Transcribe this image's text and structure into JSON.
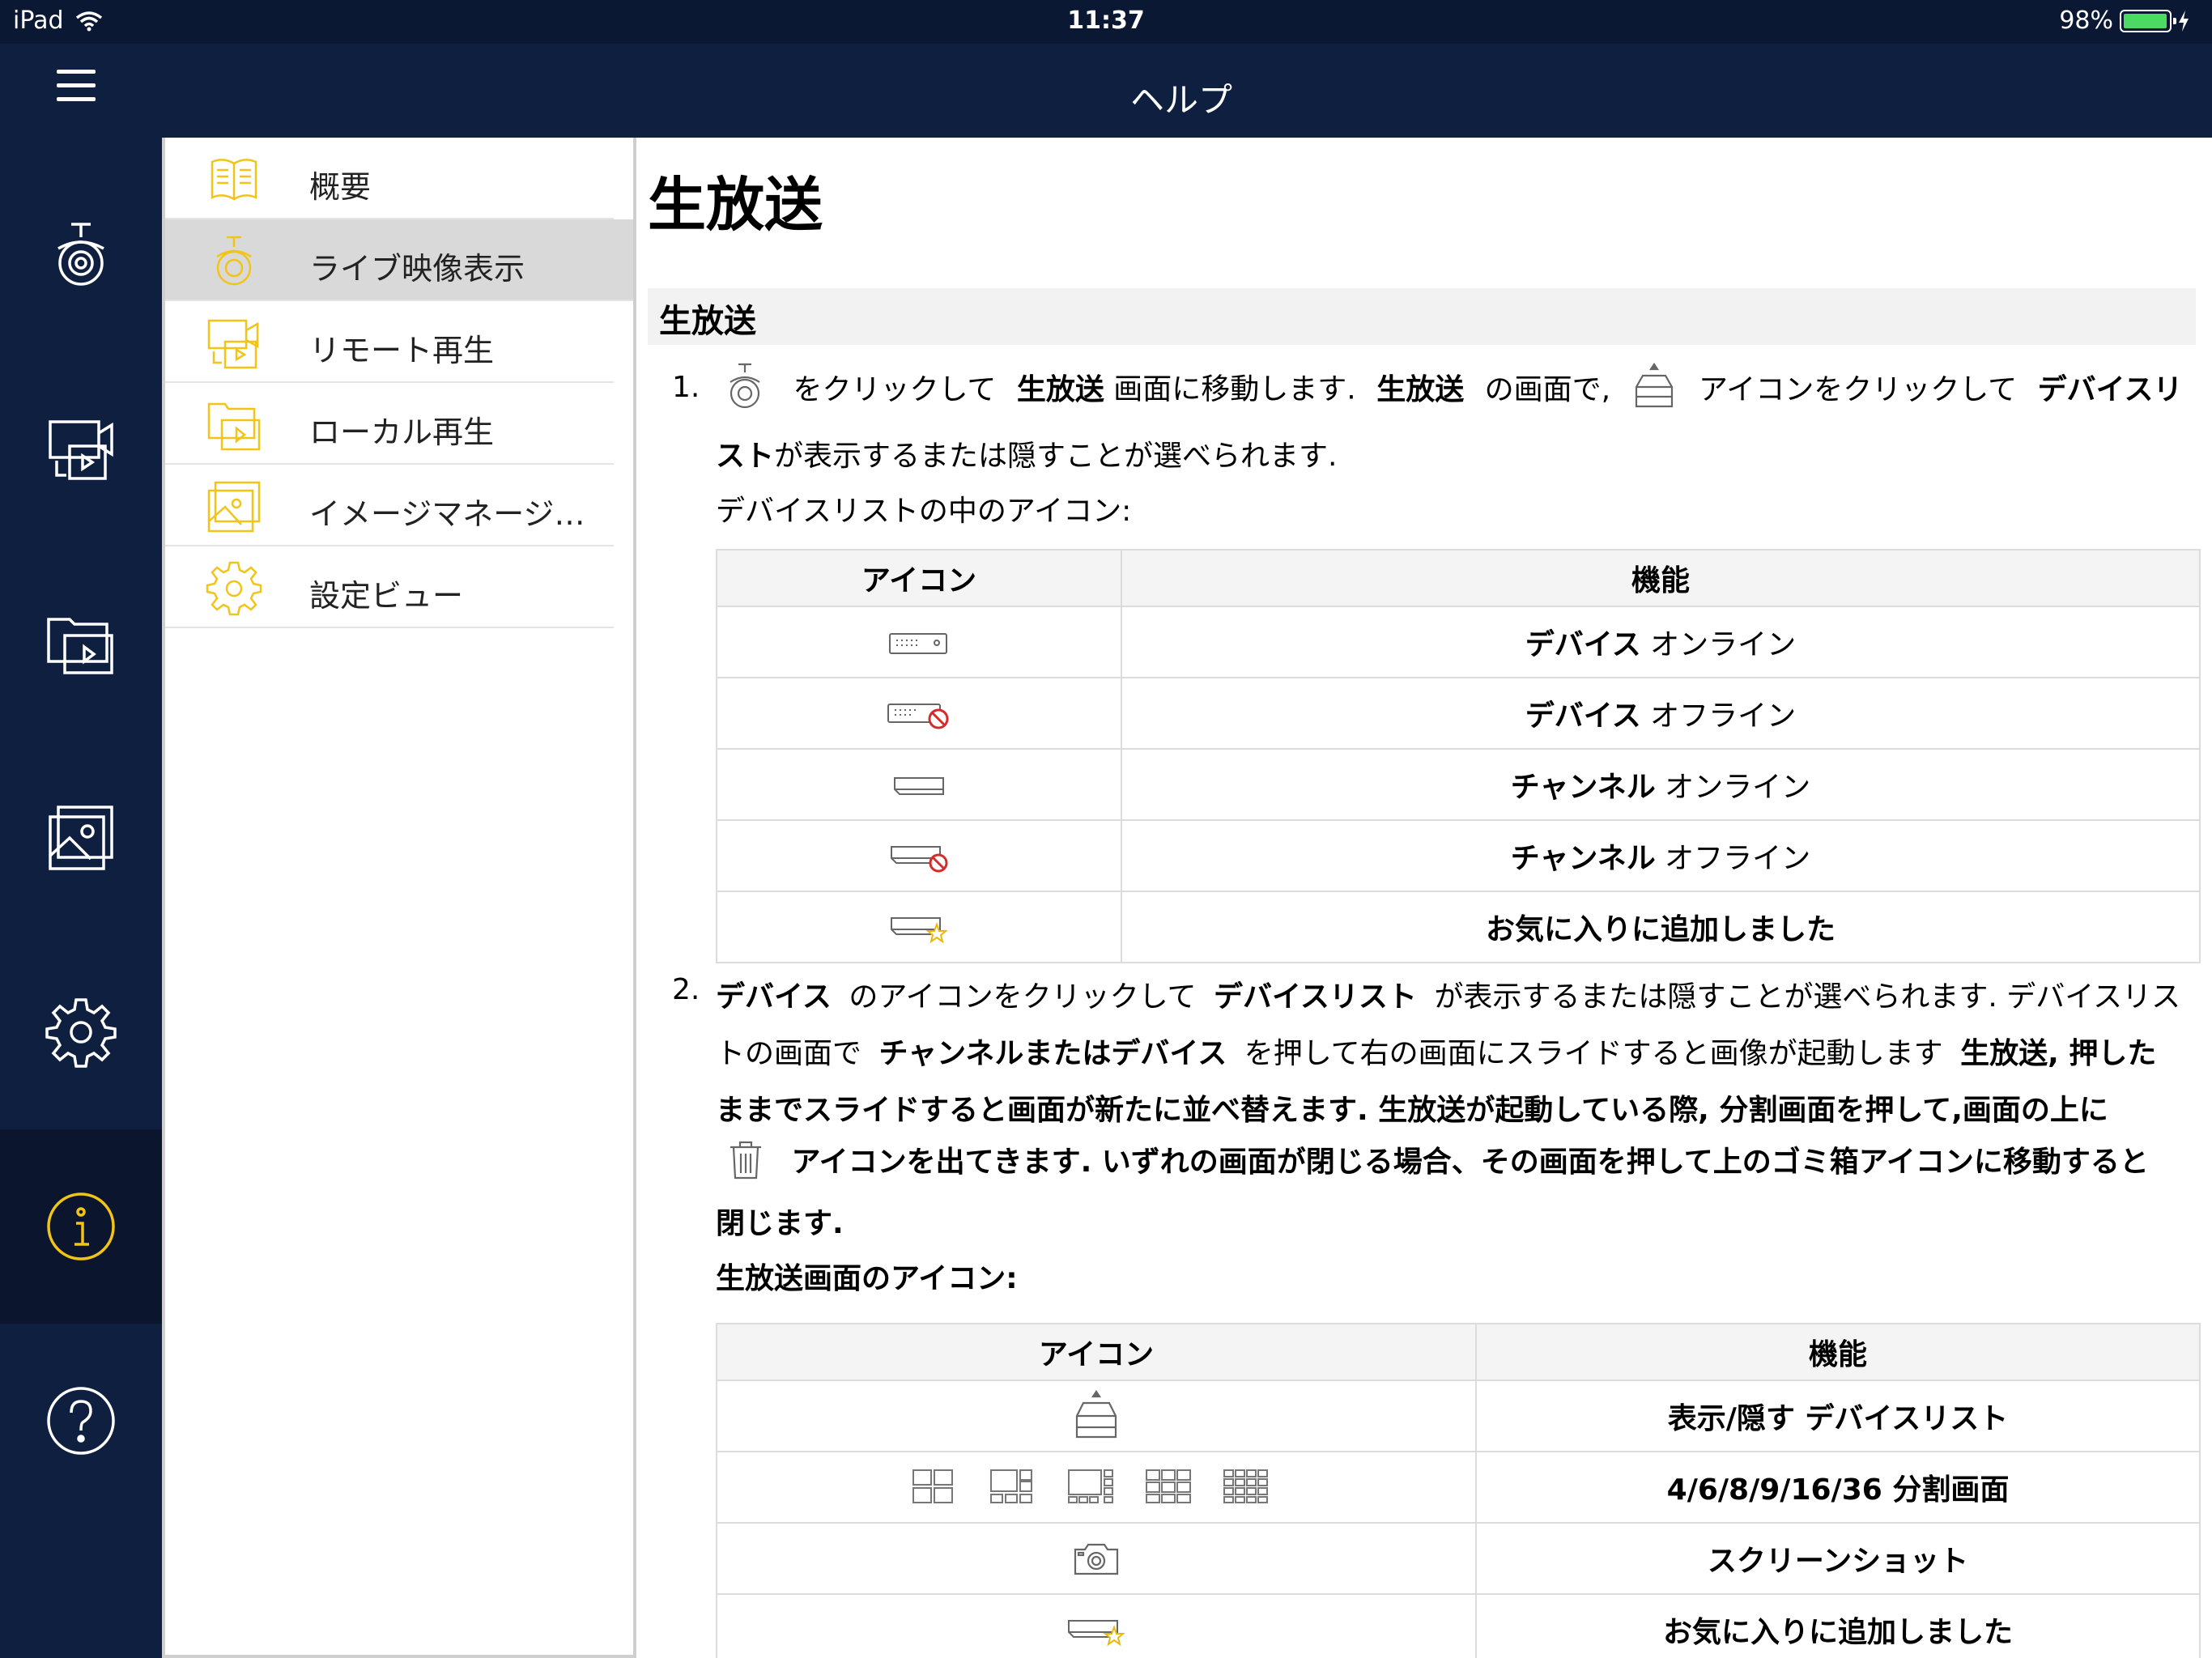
{
  "status_bar": {
    "device": "iPad",
    "time": "11:37",
    "battery": "98%",
    "battery_level": 0.98
  },
  "nav": {
    "title": "ヘルプ"
  },
  "rail": {
    "items": [
      {
        "icon": "live-camera-icon"
      },
      {
        "icon": "remote-playback-icon"
      },
      {
        "icon": "local-playback-icon"
      },
      {
        "icon": "image-manager-icon"
      },
      {
        "icon": "settings-icon"
      },
      {
        "icon": "info-icon",
        "active": true
      },
      {
        "icon": "help-icon"
      }
    ]
  },
  "menu": {
    "items": [
      {
        "label": "概要",
        "icon": "book-icon"
      },
      {
        "label": "ライブ映像表示",
        "icon": "camera-icon",
        "selected": true
      },
      {
        "label": "リモート再生",
        "icon": "remote-playback-icon"
      },
      {
        "label": "ローカル再生",
        "icon": "local-playback-icon"
      },
      {
        "label": "イメージマネージ…",
        "icon": "image-icon"
      },
      {
        "label": "設定ビュー",
        "icon": "gear-icon"
      }
    ]
  },
  "content": {
    "title": "生放送",
    "section": "生放送",
    "step1": {
      "num": "1.",
      "t1": "をクリックして",
      "b1": "生放送",
      "t2": "画面に移動します.",
      "b2": "生放送",
      "t3": "の画面で,",
      "t4": "アイコンをクリックして",
      "b3": "デバイスリ",
      "b4": "スト",
      "t5": "が表示するまたは隠すことが選べられます.",
      "sub": "デバイスリストの中のアイコン:"
    },
    "table1": {
      "headers": [
        "アイコン",
        "機能"
      ],
      "rows": [
        {
          "icon": "device-online-icon",
          "bold": "デバイス",
          "text": "オンライン"
        },
        {
          "icon": "device-offline-icon",
          "bold": "デバイス",
          "text": "オフライン"
        },
        {
          "icon": "channel-online-icon",
          "bold": "チャンネル",
          "text": "オンライン"
        },
        {
          "icon": "channel-offline-icon",
          "bold": "チャンネル",
          "text": "オフライン"
        },
        {
          "icon": "channel-favorite-icon",
          "bold": "お気に入りに追加しました",
          "text": ""
        }
      ]
    },
    "step2": {
      "num": "2.",
      "l1_b1": "デバイス",
      "l1_t1": "のアイコンをクリックして",
      "l1_b2": "デバイスリスト",
      "l1_t2": "が表示するまたは隠すことが選べられます. デバイスリス",
      "l2_t1": "トの画面で",
      "l2_b1": "チャンネルまたはデバイス",
      "l2_t2": "を押して右の画面にスライドすると画像が起動します",
      "l2_b2": "生放送, 押した",
      "l3": "ままでスライドすると画面が新たに並べ替えます. 生放送が起動している際, 分割画面を押して,画面の上に",
      "l4": "アイコンを出てきます. いずれの画面が閉じる場合、その画面を押して上のゴミ箱アイコンに移動すると",
      "l5": "閉じます.",
      "sub": "生放送画面のアイコン:"
    },
    "table2": {
      "headers": [
        "アイコン",
        "機能"
      ],
      "rows": [
        {
          "icon": "device-list-toggle-icon",
          "text": "表示/隠す デバイスリスト"
        },
        {
          "icon": "split-screen-icons",
          "text": "4/6/8/9/16/36 分割画面"
        },
        {
          "icon": "screenshot-camera-icon",
          "text": "スクリーンショット"
        },
        {
          "icon": "channel-favorite-icon",
          "text": "お気に入りに追加しました"
        }
      ]
    }
  }
}
